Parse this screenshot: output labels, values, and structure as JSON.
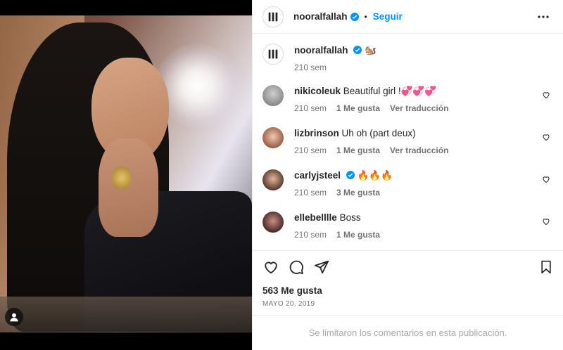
{
  "post": {
    "author": "nooralfallah",
    "follow_label": "Seguir",
    "dot": "•",
    "caption_emoji": "🐿️",
    "caption_time": "210 sem",
    "likes": "563 Me gusta",
    "date": "MAYO 20, 2019",
    "comments_limited": "Se limitaron los comentarios en esta publicación."
  },
  "comments": [
    {
      "user": "nikicoleuk",
      "text": "Beautiful girl !💞💞💞",
      "time": "210 sem",
      "likes": "1 Me gusta",
      "translate": "Ver traducción",
      "verified": false
    },
    {
      "user": "lizbrinson",
      "text": "Uh oh (part deux)",
      "time": "210 sem",
      "likes": "1 Me gusta",
      "translate": "Ver traducción",
      "verified": false
    },
    {
      "user": "carlyjsteel",
      "text": "🔥🔥🔥",
      "time": "210 sem",
      "likes": "3 Me gusta",
      "translate": "",
      "verified": true
    },
    {
      "user": "ellebelllle",
      "text": "Boss",
      "time": "210 sem",
      "likes": "1 Me gusta",
      "translate": "",
      "verified": false
    }
  ],
  "icons": {
    "more": "more-options-icon",
    "like": "heart-icon",
    "comment": "comment-icon",
    "share": "share-icon",
    "save": "bookmark-icon",
    "verified": "verified-badge-icon",
    "tag": "user-tag-icon"
  },
  "colors": {
    "accent": "#0095f6",
    "secondary_text": "#737373",
    "muted_text": "#a8a8a8",
    "border": "#efefef"
  }
}
